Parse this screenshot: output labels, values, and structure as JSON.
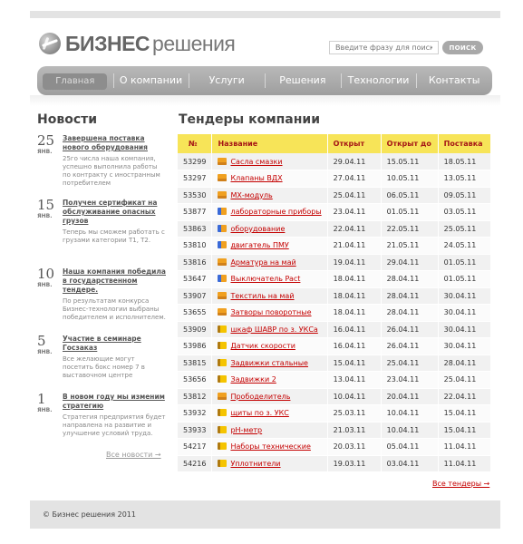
{
  "logo": {
    "bold": "БИЗНЕС",
    "light": "решения"
  },
  "search": {
    "placeholder": "Введите фразу для поиска",
    "button": "ПОИСК"
  },
  "nav": [
    "Главная",
    "О компании",
    "Услуги",
    "Решения",
    "Технологии",
    "Контакты"
  ],
  "news": {
    "title": "Новости",
    "items": [
      {
        "day": "25",
        "month": "ЯНВ.",
        "link": "Завершена поставка нового оборудования",
        "text": "25го числа наша компания, успешно выполнила работы по контракту с иностранным потребителем"
      },
      {
        "day": "15",
        "month": "ЯНВ.",
        "link": "Получен сертификат на обслуживание опасных грузов",
        "text": "Теперь мы сможем работать с грузами категории Т1, Т2."
      },
      {
        "day": "10",
        "month": "ЯНВ.",
        "link": "Наша компания победила в государственном тендере.",
        "text": "По результатам конкурса Бизнес-технологии выбраны победителем и исполнителем."
      },
      {
        "day": "5",
        "month": "ЯНВ.",
        "link": "Участие в семинаре Госзаказ",
        "text": "Все желающие могут посетить бокс номер 7 в выставочном центре"
      },
      {
        "day": "1",
        "month": "ЯНВ.",
        "link": "В новом году мы изменим стратегию",
        "text": "Стратегия предприятия будет направлена на развитие и улучшение условий труда."
      }
    ],
    "all": "Все новости →"
  },
  "tenders": {
    "title": "Тендеры компании",
    "columns": [
      "№",
      "Название",
      "Открыт",
      "Открыт до",
      "Поставка"
    ],
    "rows": [
      {
        "id": "53299",
        "icon": "box",
        "name": "Сасла смазки",
        "opened": "29.04.11",
        "until": "15.05.11",
        "delivery": "18.05.11"
      },
      {
        "id": "53297",
        "icon": "box",
        "name": "Клапаны ВДХ",
        "opened": "27.04.11",
        "until": "10.05.11",
        "delivery": "13.05.11"
      },
      {
        "id": "53530",
        "icon": "box",
        "name": "МХ-модуль",
        "opened": "25.04.11",
        "until": "06.05.11",
        "delivery": "09.05.11"
      },
      {
        "id": "53877",
        "icon": "tools",
        "name": "лабораторные приборы",
        "opened": "23.04.11",
        "until": "01.05.11",
        "delivery": "03.05.11"
      },
      {
        "id": "53863",
        "icon": "tools",
        "name": "оборудование",
        "opened": "22.04.11",
        "until": "22.05.11",
        "delivery": "25.05.11"
      },
      {
        "id": "53810",
        "icon": "tools",
        "name": "двигатель ПМУ",
        "opened": "21.04.11",
        "until": "21.05.11",
        "delivery": "24.05.11"
      },
      {
        "id": "53816",
        "icon": "box",
        "name": "Арматура на май",
        "opened": "19.04.11",
        "until": "29.04.11",
        "delivery": "01.05.11"
      },
      {
        "id": "53647",
        "icon": "tools",
        "name": "Выключатель Pact",
        "opened": "18.04.11",
        "until": "28.04.11",
        "delivery": "01.05.11"
      },
      {
        "id": "53907",
        "icon": "box",
        "name": "Текстиль на май",
        "opened": "18.04.11",
        "until": "28.04.11",
        "delivery": "30.04.11"
      },
      {
        "id": "53655",
        "icon": "box",
        "name": "Затворы поворотные",
        "opened": "18.04.11",
        "until": "28.04.11",
        "delivery": "30.04.11"
      },
      {
        "id": "53909",
        "icon": "flag",
        "name": "шкаф ШАВР по з. УКСа",
        "opened": "16.04.11",
        "until": "26.04.11",
        "delivery": "30.04.11"
      },
      {
        "id": "53986",
        "icon": "flag",
        "name": "Датчик скорости",
        "opened": "16.04.11",
        "until": "26.04.11",
        "delivery": "30.04.11"
      },
      {
        "id": "53815",
        "icon": "flag",
        "name": "Задвижки стальные",
        "opened": "15.04.11",
        "until": "25.04.11",
        "delivery": "28.04.11"
      },
      {
        "id": "53656",
        "icon": "flag",
        "name": "Задвижки 2",
        "opened": "13.04.11",
        "until": "23.04.11",
        "delivery": "25.04.11"
      },
      {
        "id": "53812",
        "icon": "box",
        "name": "Прободелитель",
        "opened": "10.04.11",
        "until": "20.04.11",
        "delivery": "22.04.11"
      },
      {
        "id": "53932",
        "icon": "flag",
        "name": "щиты по з. УКС",
        "opened": "25.03.11",
        "until": "10.04.11",
        "delivery": "15.04.11"
      },
      {
        "id": "53933",
        "icon": "flag",
        "name": "рН-метр",
        "opened": "21.03.11",
        "until": "10.04.11",
        "delivery": "15.04.11"
      },
      {
        "id": "54217",
        "icon": "flag",
        "name": "Наборы технические",
        "opened": "20.03.11",
        "until": "05.04.11",
        "delivery": "11.04.11"
      },
      {
        "id": "54216",
        "icon": "flag",
        "name": "Уплотнители",
        "opened": "19.03.11",
        "until": "03.04.11",
        "delivery": "11.04.11"
      }
    ],
    "all": "Все тендеры →"
  },
  "footer": "© Бизнес решения 2011"
}
